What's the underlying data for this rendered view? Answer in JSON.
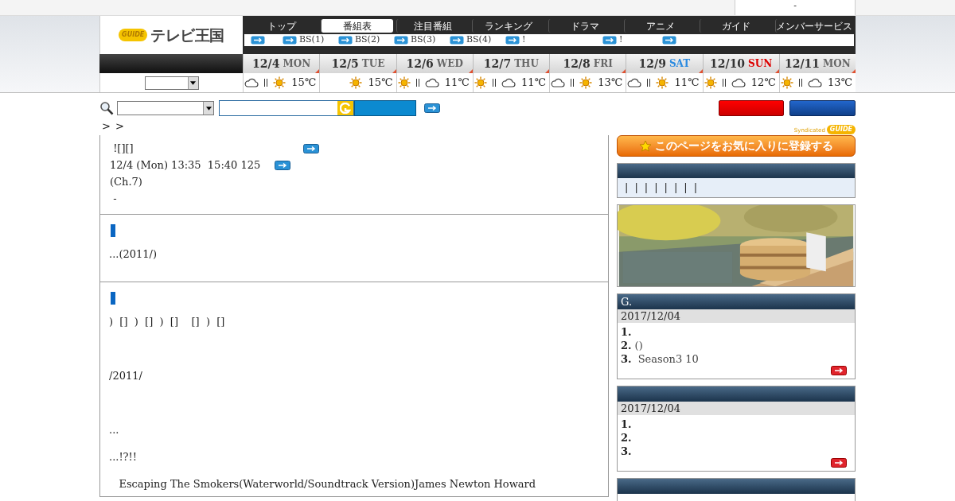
{
  "top_bar": {
    "account": "-"
  },
  "logo": {
    "badge": "GUIDE",
    "title": "テレビ王国"
  },
  "nav_tabs": [
    {
      "label": "トップ",
      "selected": false
    },
    {
      "label": "番組表",
      "selected": true
    },
    {
      "label": "注目番組",
      "selected": false
    },
    {
      "label": "ランキング",
      "selected": false
    },
    {
      "label": "ドラマ",
      "selected": false
    },
    {
      "label": "アニメ",
      "selected": false
    },
    {
      "label": "ガイド",
      "selected": false
    },
    {
      "label": "メンバーサービス",
      "selected": false
    }
  ],
  "sub_nav": [
    {
      "kind": "arrow"
    },
    {
      "kind": "link",
      "label": "BS(1)"
    },
    {
      "kind": "link",
      "label": "BS(2)"
    },
    {
      "kind": "link",
      "label": "BS(3)"
    },
    {
      "kind": "link",
      "label": "BS(4)"
    },
    {
      "kind": "link",
      "label": "!"
    },
    {
      "kind": "link",
      "label": "!"
    },
    {
      "kind": "arrow"
    }
  ],
  "days": [
    {
      "date": "12/4",
      "weekday": "MON",
      "kind": "weekday",
      "weather": [
        {
          "kind": "cloud"
        },
        {
          "kind": "sun"
        }
      ],
      "temp": "15℃"
    },
    {
      "date": "12/5",
      "weekday": "TUE",
      "kind": "weekday",
      "weather": [
        {
          "kind": "sun"
        }
      ],
      "temp": "15℃"
    },
    {
      "date": "12/6",
      "weekday": "WED",
      "kind": "weekday",
      "weather": [
        {
          "kind": "sun"
        },
        {
          "kind": "cloud"
        }
      ],
      "temp": "11℃"
    },
    {
      "date": "12/7",
      "weekday": "THU",
      "kind": "weekday",
      "weather": [
        {
          "kind": "sun"
        },
        {
          "kind": "cloud"
        }
      ],
      "temp": "11℃"
    },
    {
      "date": "12/8",
      "weekday": "FRI",
      "kind": "weekday",
      "weather": [
        {
          "kind": "cloud"
        },
        {
          "kind": "sun"
        }
      ],
      "temp": "13℃"
    },
    {
      "date": "12/9",
      "weekday": "SAT",
      "kind": "saturday",
      "weather": [
        {
          "kind": "cloud"
        },
        {
          "kind": "sun"
        }
      ],
      "temp": "11℃"
    },
    {
      "date": "12/10",
      "weekday": "SUN",
      "kind": "sunday",
      "weather": [
        {
          "kind": "sun"
        },
        {
          "kind": "cloud"
        }
      ],
      "temp": "12℃"
    },
    {
      "date": "12/11",
      "weekday": "MON",
      "kind": "weekday",
      "weather": [
        {
          "kind": "sun"
        },
        {
          "kind": "cloud"
        }
      ],
      "temp": "13℃"
    }
  ],
  "breadcrumb": [
    ">",
    ">"
  ],
  "syndicated": {
    "label": "Syndicated",
    "badge": "GUIDE"
  },
  "program": {
    "title": " ![][]",
    "airtime": "12/4 (Mon) 13:35  15:40 125",
    "channel": "(Ch.7)",
    "note": " -"
  },
  "sections": [
    {
      "lines": [
        {
          "kind": "plain",
          "text": "...(2011/)"
        }
      ]
    },
    {
      "lines": [
        {
          "kind": "plain",
          "text": ")  []  )  []  )  []    []  )  []"
        },
        {
          "kind": "spaced",
          "text": "/2011/"
        },
        {
          "kind": "spaced",
          "text": "..."
        },
        {
          "kind": "plain",
          "text": "...!?!!"
        },
        {
          "kind": "plain",
          "text": "   Escaping The Smokers(Waterworld/Soundtrack Version)James Newton Howard"
        }
      ]
    }
  ],
  "favorite_banner": "このページをお気に入りに登録する",
  "genre_links": [
    "|",
    "|",
    "|",
    "|",
    "|",
    "|",
    "|",
    "|"
  ],
  "ad": {
    "kind": "picture"
  },
  "rankings": [
    {
      "kind": "full",
      "title": "G.",
      "date": "2017/12/04",
      "items": [
        {
          "rank": "1."
        },
        {
          "rank": "2.",
          "text": "()"
        },
        {
          "rank": "3.",
          "text": " Season3 10"
        }
      ]
    },
    {
      "kind": "full",
      "date": "2017/12/04",
      "items": [
        {
          "rank": "1."
        },
        {
          "rank": "2."
        },
        {
          "rank": "3."
        }
      ]
    },
    {
      "kind": "header_only"
    }
  ]
}
